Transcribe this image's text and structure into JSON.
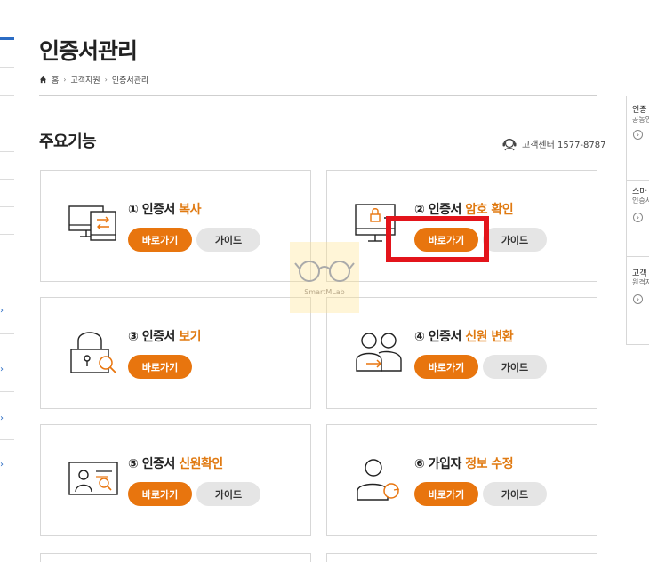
{
  "header": {
    "title": "인증서관리",
    "breadcrumb": [
      "홈",
      "고객지원",
      "인증서관리"
    ]
  },
  "section": {
    "title": "주요기능",
    "customer_center": "고객센터 1577-8787"
  },
  "cards": [
    {
      "num": "①",
      "title_prefix": "인증서",
      "title_highlight": "복사",
      "icon": "computer-transfer-icon",
      "go_label": "바로가기",
      "guide_label": "가이드"
    },
    {
      "num": "②",
      "title_prefix": "인증서",
      "title_highlight": "암호 확인",
      "icon": "monitor-lock-password-icon",
      "go_label": "바로가기",
      "guide_label": "가이드"
    },
    {
      "num": "③",
      "title_prefix": "인증서",
      "title_highlight": "보기",
      "icon": "lock-magnifier-icon",
      "go_label": "바로가기",
      "guide_label": "가이드"
    },
    {
      "num": "④",
      "title_prefix": "인증서",
      "title_highlight": "신원 변환",
      "icon": "two-person-transfer-icon",
      "go_label": "바로가기",
      "guide_label": "가이드"
    },
    {
      "num": "⑤",
      "title_prefix": "인증서",
      "title_highlight": "신원확인",
      "icon": "id-card-check-icon",
      "go_label": "바로가기",
      "guide_label": "가이드"
    },
    {
      "num": "⑥",
      "title_prefix": "가입자",
      "title_highlight": "정보 수정",
      "icon": "user-refresh-icon",
      "go_label": "바로가기",
      "guide_label": "가이드"
    }
  ],
  "right_panel": {
    "items": [
      {
        "title": "인증",
        "sub": "공동인"
      },
      {
        "title": "스마",
        "sub": "인증서"
      },
      {
        "title": "고객",
        "sub": "원격지"
      }
    ]
  },
  "watermark": {
    "text": "SmartMLab"
  },
  "colors": {
    "accent": "#e8750e",
    "highlight_box": "#e3141b",
    "guide_bg": "#e5e5e5"
  }
}
